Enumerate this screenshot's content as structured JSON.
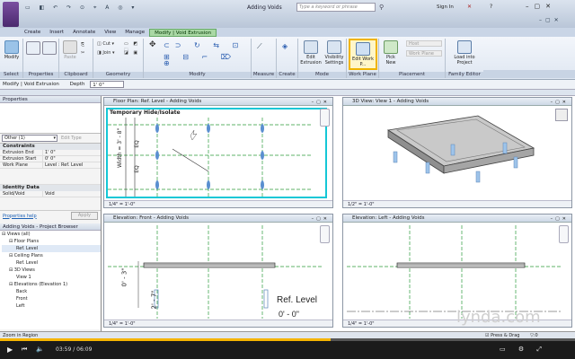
{
  "window": {
    "title": "Adding Voids",
    "search_placeholder": "Type a keyword or phrase",
    "sign_in": "Sign In"
  },
  "ribbon_tabs": [
    "Create",
    "Insert",
    "Annotate",
    "View",
    "Manage",
    "Modify | Void Extrusion"
  ],
  "ribbon": {
    "select": {
      "button": "Modify",
      "panel": "Select"
    },
    "properties_panel": "Properties",
    "clipboard": {
      "paste": "Paste",
      "panel": "Clipboard"
    },
    "geometry": {
      "cut": "Cut",
      "join": "Join",
      "panel": "Geometry"
    },
    "modify_panel": "Modify",
    "measure_panel": "Measure",
    "create_panel": "Create",
    "mode": {
      "edit_extrusion": "Edit Extrusion",
      "visibility_settings": "Visibility Settings",
      "panel": "Mode"
    },
    "work_plane": {
      "edit_work_plane": "Edit Work P...",
      "panel": "Work Plane"
    },
    "placement": {
      "pick_new": "Pick New",
      "host": "Host",
      "work_plane": "Work Plane",
      "panel": "Placement"
    },
    "family_editor": {
      "load_into_project": "Load into Project",
      "panel": "Family Editor"
    }
  },
  "options_bar": {
    "context": "Modify | Void Extrusion",
    "depth_label": "Depth",
    "depth_value": "1'  0\""
  },
  "properties": {
    "header": "Properties",
    "type_selector": "Other (1)",
    "edit_type": "Edit Type",
    "cat_constraints": "Constraints",
    "rows": [
      {
        "k": "Extrusion End",
        "v": "1'  0\""
      },
      {
        "k": "Extrusion Start",
        "v": "0'  0\""
      },
      {
        "k": "Work Plane",
        "v": "Level : Ref. Level"
      }
    ],
    "cat_identity": "Identity Data",
    "identity_rows": [
      {
        "k": "Solid/Void",
        "v": "Void"
      }
    ],
    "help": "Properties help",
    "apply": "Apply"
  },
  "browser": {
    "header": "Adding Voids - Project Browser",
    "items": [
      {
        "label": "Views (all)",
        "indent": 0
      },
      {
        "label": "Floor Plans",
        "indent": 1
      },
      {
        "label": "Ref. Level",
        "indent": 2
      },
      {
        "label": "Ceiling Plans",
        "indent": 1
      },
      {
        "label": "Ref. Level",
        "indent": 2
      },
      {
        "label": "3D Views",
        "indent": 1
      },
      {
        "label": "View 1",
        "indent": 2
      },
      {
        "label": "Elevations (Elevation 1)",
        "indent": 1
      },
      {
        "label": "Back",
        "indent": 2
      },
      {
        "label": "Front",
        "indent": 2
      },
      {
        "label": "Left",
        "indent": 2
      }
    ]
  },
  "views": {
    "floor_plan": {
      "title": "Floor Plan: Ref. Level - Adding Voids",
      "banner": "Temporary Hide/Isolate",
      "width_dim": "Width = 3' - 8\"",
      "eq": "EQ",
      "scale": "1/4\" = 1'-0\""
    },
    "view3d": {
      "title": "3D View: View 1 - Adding Voids",
      "scale": "1/2\" = 1'-0\""
    },
    "front": {
      "title": "Elevation: Front - Adding Voids",
      "dim1": "0' - 3\"",
      "dim2": "2' - 7\"",
      "scale": "1/4\" = 1'-0\""
    },
    "left": {
      "title": "Elevation: Left - Adding Voids",
      "level": "Ref. Level",
      "level_value": "0' - 0\"",
      "scale": "1/4\" = 1'-0\""
    }
  },
  "status": {
    "text": "Zoom in Region",
    "press_drag": "Press & Drag",
    "zero": ":0"
  },
  "player": {
    "time": "03:59 / 06:09",
    "progress": 0.575
  },
  "watermark": "lynda.com"
}
